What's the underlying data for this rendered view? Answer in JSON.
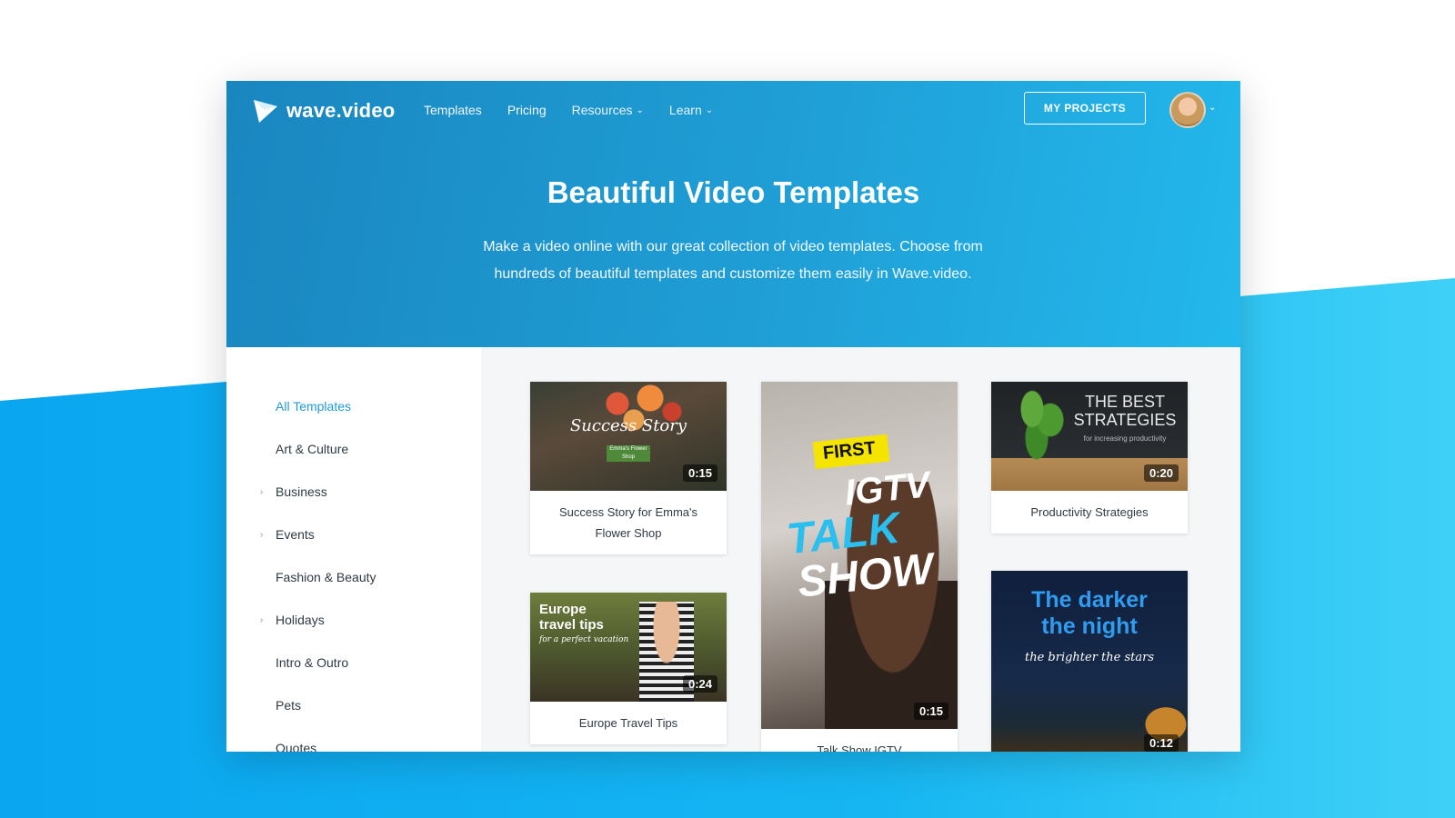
{
  "header": {
    "logo_text": "wave.video",
    "nav": {
      "templates": "Templates",
      "pricing": "Pricing",
      "resources": "Resources",
      "learn": "Learn"
    },
    "my_projects": "MY PROJECTS",
    "title": "Beautiful Video Templates",
    "subtitle": "Make a video online with our great collection of video templates. Choose from hundreds of beautiful templates and customize them easily in Wave.video."
  },
  "sidebar": {
    "items": [
      {
        "label": "All Templates"
      },
      {
        "label": "Art & Culture"
      },
      {
        "label": "Business"
      },
      {
        "label": "Events"
      },
      {
        "label": "Fashion & Beauty"
      },
      {
        "label": "Holidays"
      },
      {
        "label": "Intro & Outro"
      },
      {
        "label": "Pets"
      },
      {
        "label": "Quotes"
      }
    ]
  },
  "cards": {
    "flower": {
      "overlay": "Success Story",
      "badge": "Emma's Flower Shop",
      "duration": "0:15",
      "caption": "Success Story for Emma's Flower Shop"
    },
    "europe": {
      "overlay_line1": "Europe",
      "overlay_line2": "travel tips",
      "overlay_line3": "for a perfect vacation",
      "duration": "0:24",
      "caption": "Europe Travel Tips"
    },
    "talkshow": {
      "overlay_first": "FIRST",
      "overlay_igtv": "IGTV",
      "overlay_talk": "TALK",
      "overlay_show": "SHOW",
      "duration": "0:15",
      "caption": "Talk Show IGTV"
    },
    "productivity": {
      "overlay_line1": "THE BEST",
      "overlay_line2": "STRATEGIES",
      "overlay_line3": "for increasing productivity",
      "duration": "0:20",
      "caption": "Productivity Strategies"
    },
    "night": {
      "overlay_line1": "The darker",
      "overlay_line2": "the night",
      "overlay_line3": "the brighter the stars",
      "duration": "0:12"
    }
  }
}
